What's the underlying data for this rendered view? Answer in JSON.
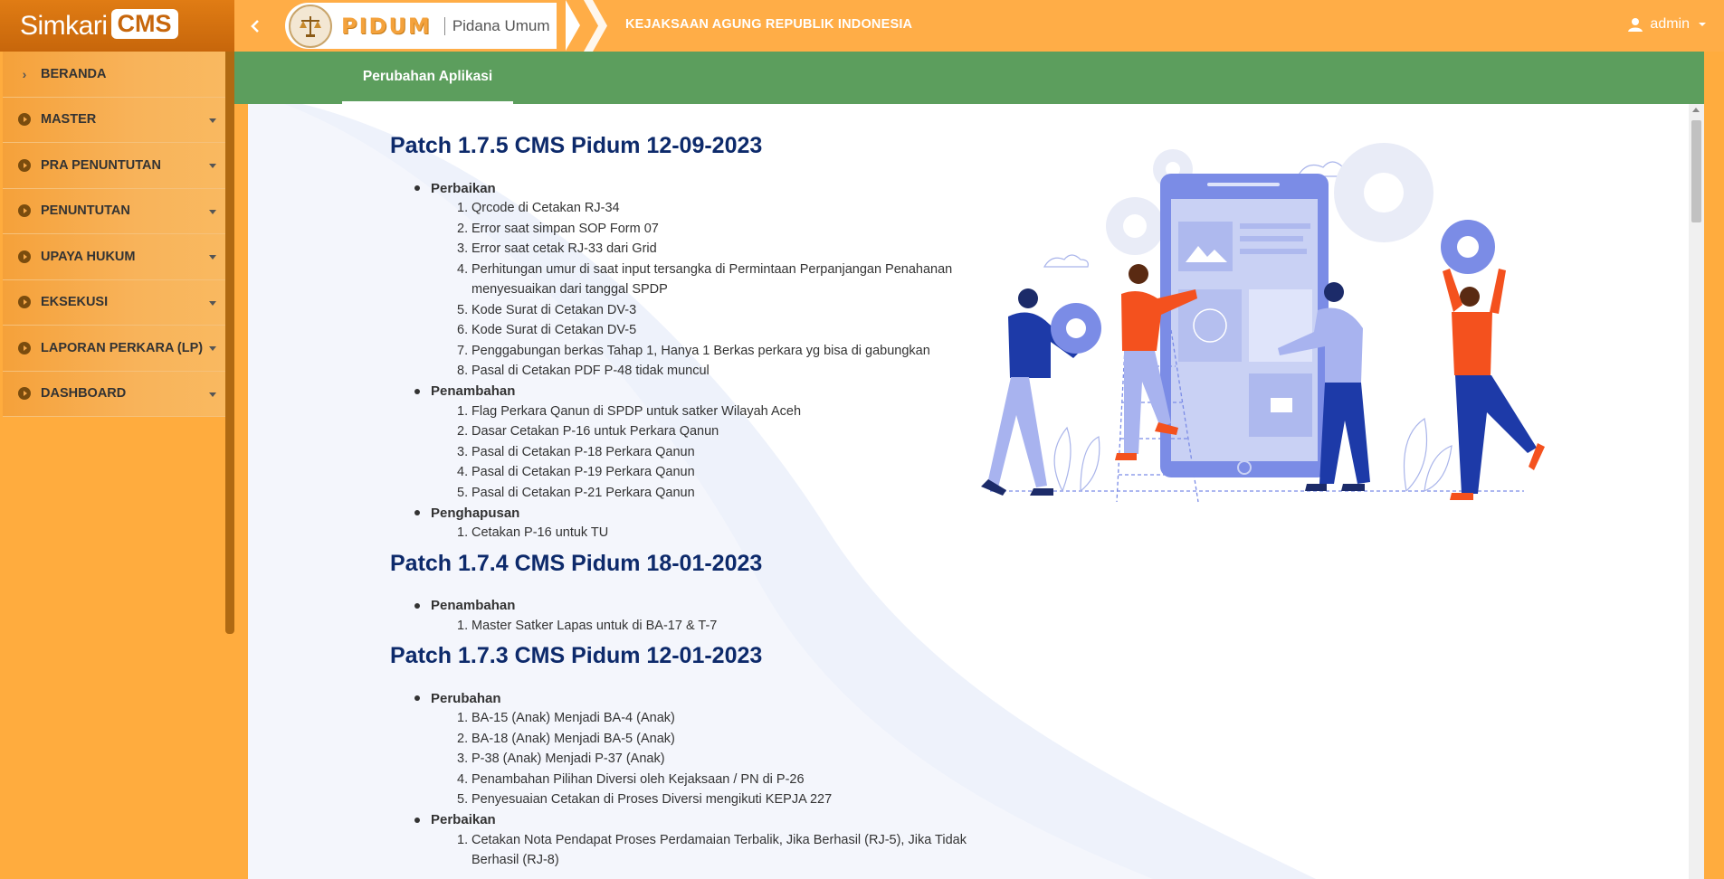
{
  "header": {
    "brand_text": "Simkari",
    "brand_badge": "CMS",
    "module_logo": "PIDUM",
    "module_name": "Pidana Umum",
    "agency": "KEJAKSAAN AGUNG REPUBLIK INDONESIA",
    "user": "admin",
    "icons": {
      "collapse": "chevron-left-icon",
      "user": "user-icon",
      "seal": "scales-of-justice-icon"
    }
  },
  "sidebar": {
    "items": [
      {
        "label": "BERANDA",
        "icon": "chevron-right-icon",
        "has_dropdown": false
      },
      {
        "label": "MASTER",
        "icon": "circle-arrow-right-icon",
        "has_dropdown": true
      },
      {
        "label": "PRA PENUNTUTAN",
        "icon": "circle-arrow-right-icon",
        "has_dropdown": true
      },
      {
        "label": "PENUNTUTAN",
        "icon": "circle-arrow-right-icon",
        "has_dropdown": true
      },
      {
        "label": "UPAYA HUKUM",
        "icon": "circle-arrow-right-icon",
        "has_dropdown": true
      },
      {
        "label": "EKSEKUSI",
        "icon": "circle-arrow-right-icon",
        "has_dropdown": true
      },
      {
        "label": "LAPORAN PERKARA (LP)",
        "icon": "circle-arrow-right-icon",
        "has_dropdown": true
      },
      {
        "label": "DASHBOARD",
        "icon": "circle-arrow-right-icon",
        "has_dropdown": true
      }
    ]
  },
  "tabs": [
    {
      "label": "Perubahan Aplikasi",
      "active": true
    }
  ],
  "patches": [
    {
      "title": "Patch 1.7.5 CMS Pidum 12-09-2023",
      "sections": [
        {
          "heading": "Perbaikan",
          "items": [
            "Qrcode di Cetakan RJ-34",
            "Error saat simpan SOP Form 07",
            "Error saat cetak RJ-33 dari Grid",
            "Perhitungan umur di saat input tersangka di Permintaan Perpanjangan Penahanan menyesuaikan dari tanggal SPDP",
            "Kode Surat di Cetakan DV-3",
            "Kode Surat di Cetakan DV-5",
            "Penggabungan berkas Tahap 1, Hanya 1 Berkas perkara yg bisa di gabungkan",
            "Pasal di Cetakan PDF P-48 tidak muncul"
          ]
        },
        {
          "heading": "Penambahan",
          "items": [
            "Flag Perkara Qanun di SPDP untuk satker Wilayah Aceh",
            "Dasar Cetakan P-16 untuk Perkara Qanun",
            "Pasal di Cetakan P-18 Perkara Qanun",
            "Pasal di Cetakan P-19 Perkara Qanun",
            "Pasal di Cetakan P-21 Perkara Qanun"
          ]
        },
        {
          "heading": "Penghapusan",
          "items": [
            "Cetakan P-16 untuk TU"
          ]
        }
      ]
    },
    {
      "title": "Patch 1.7.4 CMS Pidum 18-01-2023",
      "sections": [
        {
          "heading": "Penambahan",
          "items": [
            "Master Satker Lapas untuk di BA-17 & T-7"
          ]
        }
      ]
    },
    {
      "title": "Patch 1.7.3 CMS Pidum 12-01-2023",
      "sections": [
        {
          "heading": "Perubahan",
          "items": [
            "BA-15 (Anak) Menjadi BA-4 (Anak)",
            "BA-18 (Anak) Menjadi BA-5 (Anak)",
            "P-38 (Anak) Menjadi P-37 (Anak)",
            "Penambahan Pilihan Diversi oleh Kejaksaan / PN di P-26",
            "Penyesuaian Cetakan di Proses Diversi mengikuti KEPJA 227"
          ]
        },
        {
          "heading": "Perbaikan",
          "items": [
            "Cetakan Nota Pendapat Proses Perdamaian Terbalik, Jika Berhasil (RJ-5), Jika Tidak Berhasil (RJ-8)"
          ]
        }
      ]
    }
  ],
  "colors": {
    "orange": "#ffac3e",
    "green": "#5c9e5d",
    "title_blue": "#0d2a6b",
    "illustration_blue": "#7b8ce6",
    "illustration_red": "#f4511e"
  }
}
